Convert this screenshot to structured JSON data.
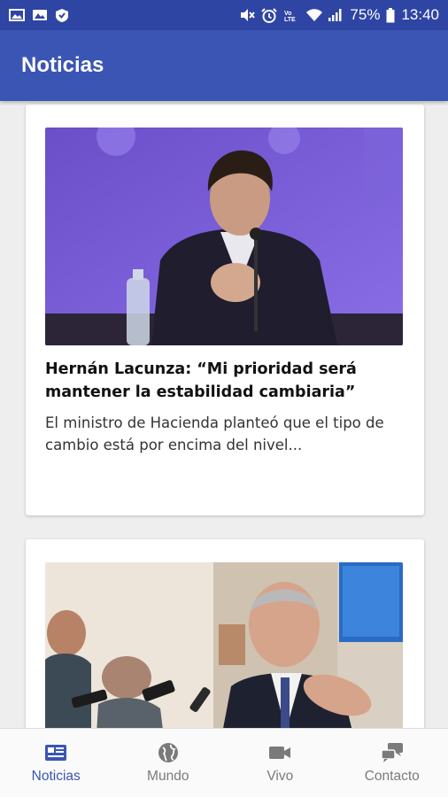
{
  "status_bar": {
    "battery": "75%",
    "time": "13:40",
    "icons": [
      "image-icon",
      "gallery-icon",
      "shield-icon",
      "mute-icon",
      "alarm-icon",
      "volte-icon",
      "wifi-icon",
      "signal-icon",
      "battery-icon"
    ]
  },
  "app_bar": {
    "title": "Noticias"
  },
  "feed": {
    "articles": [
      {
        "image": "photo-minister-press-conference",
        "headline": "Hernán Lacunza: “Mi prioridad será mantener la estabilidad cambiaria”",
        "summary": "El ministro de Hacienda planteó que el tipo de cambio está por encima del nivel..."
      },
      {
        "image": "photo-politician-with-reporters"
      }
    ]
  },
  "bottom_nav": {
    "items": [
      {
        "label": "Noticias",
        "icon": "newspaper-icon",
        "active": true
      },
      {
        "label": "Mundo",
        "icon": "globe-icon",
        "active": false
      },
      {
        "label": "Vivo",
        "icon": "video-camera-icon",
        "active": false
      },
      {
        "label": "Contacto",
        "icon": "chat-icon",
        "active": false
      }
    ]
  },
  "colors": {
    "primary": "#3a55b4",
    "primary_dark": "#2f45a3",
    "background": "#eeeeee",
    "nav_inactive": "#7a7a7a"
  }
}
